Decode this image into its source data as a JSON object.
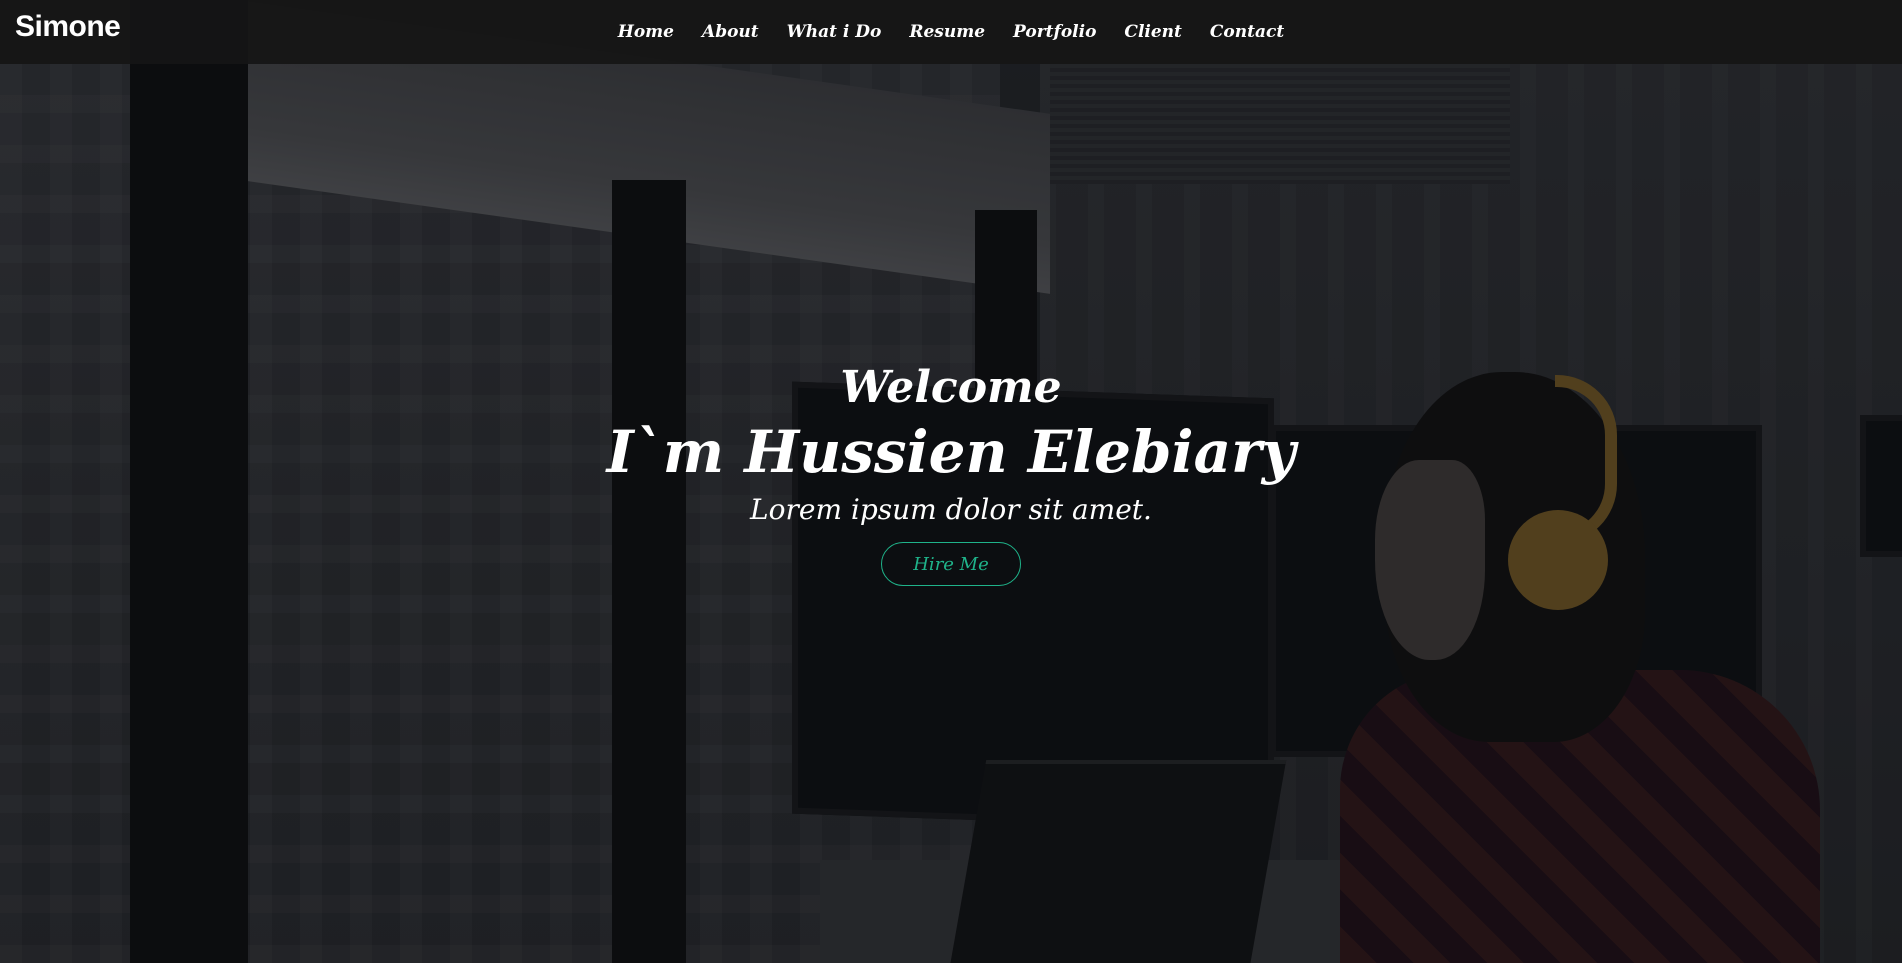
{
  "nav": {
    "brand": "Simone",
    "items": [
      {
        "label": "Home"
      },
      {
        "label": "About"
      },
      {
        "label": "What i Do"
      },
      {
        "label": "Resume"
      },
      {
        "label": "Portfolio"
      },
      {
        "label": "Client"
      },
      {
        "label": "Contact"
      }
    ]
  },
  "hero": {
    "welcome": "Welcome",
    "name": "I`m Hussien Elebiary",
    "tagline": "Lorem ipsum dolor sit amet.",
    "cta_label": "Hire Me"
  },
  "colors": {
    "accent": "#1fb38a",
    "navbar_bg": "#161616",
    "text": "#ffffff"
  }
}
